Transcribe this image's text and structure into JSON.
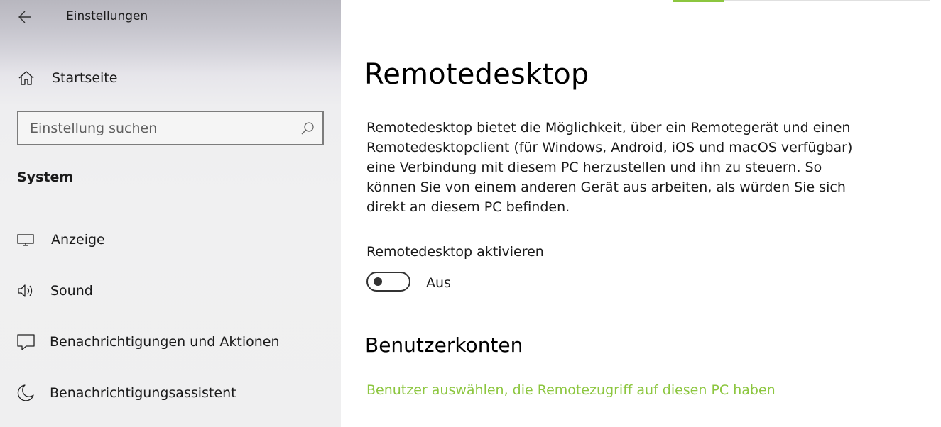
{
  "window": {
    "title": "Einstellungen"
  },
  "sidebar": {
    "home_label": "Startseite",
    "search": {
      "placeholder": "Einstellung suchen",
      "value": ""
    },
    "section_label": "System",
    "items": [
      {
        "label": "Anzeige",
        "icon": "monitor-icon"
      },
      {
        "label": "Sound",
        "icon": "speaker-icon"
      },
      {
        "label": "Benachrichtigungen und Aktionen",
        "icon": "message-icon"
      },
      {
        "label": "Benachrichtigungsassistent",
        "icon": "moon-icon"
      }
    ]
  },
  "main": {
    "title": "Remotedesktop",
    "description": "Remotedesktop bietet die Möglichkeit, über ein Remotegerät und einen Remotedesktopclient (für Windows, Android, iOS und macOS verfügbar) eine Verbindung mit diesem PC herzustellen und ihn zu steuern. So können Sie von einem anderen Gerät aus arbeiten, als würden Sie sich direkt an diesem PC befinden.",
    "toggle": {
      "label": "Remotedesktop aktivieren",
      "state": "Aus",
      "on": false
    },
    "accounts_heading": "Benutzerkonten",
    "accounts_link": "Benutzer auswählen, die Remotezugriff auf diesen PC haben"
  },
  "colors": {
    "accent": "#8cc63f",
    "sidebar_bg": "#f0f0f1",
    "toggle_off": "#333333"
  }
}
